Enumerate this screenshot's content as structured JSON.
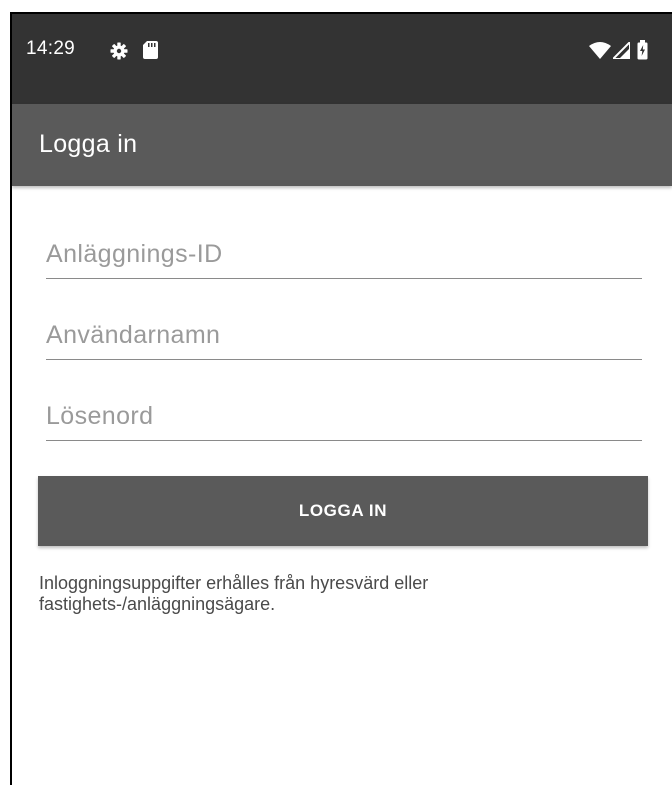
{
  "status_bar": {
    "time": "14:29",
    "icons": [
      "gear-icon",
      "sd-card-icon",
      "wifi-icon",
      "signal-icon",
      "battery-charging-icon"
    ]
  },
  "app_bar": {
    "title": "Logga in"
  },
  "form": {
    "facility_id_placeholder": "Anläggnings-ID",
    "username_placeholder": "Användarnamn",
    "password_placeholder": "Lösenord",
    "login_button_label": "LOGGA IN"
  },
  "info": {
    "text": "Inloggningsuppgifter erhålles från hyresvärd eller fastighets-/anläggningsägare."
  },
  "colors": {
    "status_bar": "#333333",
    "app_bar": "#5a5a5a",
    "button": "#5a5a5a",
    "background": "#ffffff"
  }
}
